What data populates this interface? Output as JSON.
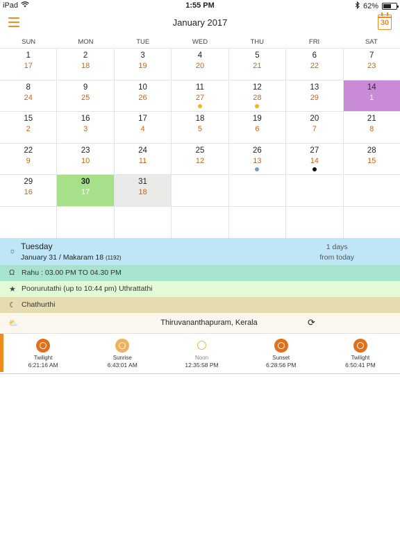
{
  "status_bar": {
    "carrier": "iPad",
    "time": "1:55 PM",
    "battery_percent": "62%",
    "battery_level": 0.62
  },
  "nav": {
    "title": "January 2017",
    "calendar_button_label": "30"
  },
  "weekdays": [
    "SUN",
    "MON",
    "TUE",
    "WED",
    "THU",
    "FRI",
    "SAT"
  ],
  "weeks": [
    [
      {
        "g": "1",
        "m": "17"
      },
      {
        "g": "2",
        "m": "18"
      },
      {
        "g": "3",
        "m": "19"
      },
      {
        "g": "4",
        "m": "20"
      },
      {
        "g": "5",
        "m": "21"
      },
      {
        "g": "6",
        "m": "22"
      },
      {
        "g": "7",
        "m": "23"
      }
    ],
    [
      {
        "g": "8",
        "m": "24"
      },
      {
        "g": "9",
        "m": "25"
      },
      {
        "g": "10",
        "m": "26"
      },
      {
        "g": "11",
        "m": "27",
        "dot": "#f0b81c"
      },
      {
        "g": "12",
        "m": "28",
        "dot": "#f0b81c"
      },
      {
        "g": "13",
        "m": "29"
      },
      {
        "g": "14",
        "m": "1",
        "state": "highlight"
      }
    ],
    [
      {
        "g": "15",
        "m": "2"
      },
      {
        "g": "16",
        "m": "3"
      },
      {
        "g": "17",
        "m": "4"
      },
      {
        "g": "18",
        "m": "5"
      },
      {
        "g": "19",
        "m": "6"
      },
      {
        "g": "20",
        "m": "7"
      },
      {
        "g": "21",
        "m": "8"
      }
    ],
    [
      {
        "g": "22",
        "m": "9"
      },
      {
        "g": "23",
        "m": "10"
      },
      {
        "g": "24",
        "m": "11"
      },
      {
        "g": "25",
        "m": "12"
      },
      {
        "g": "26",
        "m": "13",
        "dot": "#6fa3c2"
      },
      {
        "g": "27",
        "m": "14",
        "dot": "#111111"
      },
      {
        "g": "28",
        "m": "15"
      }
    ],
    [
      {
        "g": "29",
        "m": "16"
      },
      {
        "g": "30",
        "m": "17",
        "state": "selected"
      },
      {
        "g": "31",
        "m": "18",
        "state": "today"
      },
      null,
      null,
      null,
      null
    ],
    [
      null,
      null,
      null,
      null,
      null,
      null,
      null
    ]
  ],
  "day_info": {
    "day_name": "Tuesday",
    "date_line": "January 31 / Makaram 18",
    "year_note": "(1192)",
    "days_count": "1  days",
    "days_suffix": "from today"
  },
  "rahu": "Rahu : 03.00 PM TO 04.30 PM",
  "nakshatra": "Poorurutathi (up to 10:44 pm) Uthrattathi",
  "tithi": "Chathurthi",
  "location": "Thiruvananthapuram, Kerala",
  "sun_times": [
    {
      "label": "Twilight",
      "time": "6:21:16 AM",
      "style": "dark"
    },
    {
      "label": "Sunrise",
      "time": "6:43:01 AM",
      "style": "light"
    },
    {
      "label": "Noon",
      "time": "12:35:58 PM",
      "style": "noon"
    },
    {
      "label": "Sunset",
      "time": "6:28:56 PM",
      "style": "dark"
    },
    {
      "label": "Twilight",
      "time": "6:50:41 PM",
      "style": "dark"
    }
  ],
  "icons": {
    "menu": "hamburger-menu-icon",
    "calendar": "calendar-icon",
    "sun": "sun-icon",
    "omega": "omega-icon",
    "star": "star-icon",
    "moon": "moon-icon",
    "weather": "sun-cloud-icon",
    "refresh": "refresh-icon"
  },
  "colors": {
    "accent": "#ef8a1c",
    "selected": "#a6e08b",
    "highlight": "#c98ad6",
    "malayalam_date": "#c6651b"
  }
}
